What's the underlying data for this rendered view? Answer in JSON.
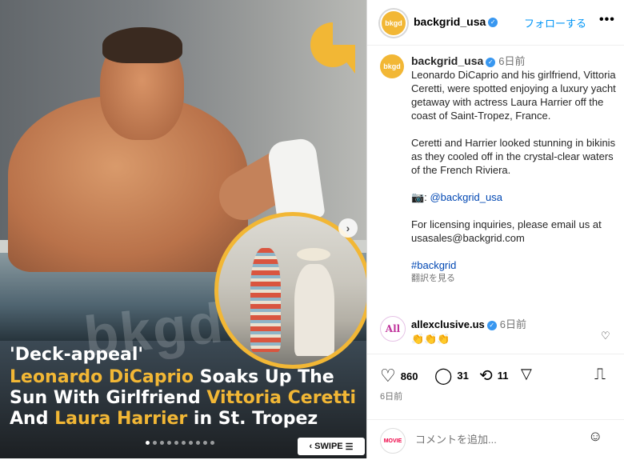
{
  "media": {
    "watermark": "bkgd",
    "caption_kicker": "'Deck-appeal'",
    "headline_parts": [
      {
        "text": "Leonardo DiCaprio",
        "highlight": true
      },
      {
        "text": " Soaks Up The Sun With Girlfriend ",
        "highlight": false
      },
      {
        "text": "Vittoria Ceretti",
        "highlight": true
      },
      {
        "text": " And ",
        "highlight": false
      },
      {
        "text": "Laura Harrier",
        "highlight": true
      },
      {
        "text": " in St. Tropez",
        "highlight": false
      }
    ],
    "swipe_label": "SWIPE",
    "slide_count": 10,
    "active_slide": 0,
    "next_icon": "chevron-right-icon",
    "accent_color": "#f2b735"
  },
  "header": {
    "avatar_text": "bkgd",
    "username": "backgrid_usa",
    "follow_label": "フォローする",
    "more_label": "•••"
  },
  "post": {
    "avatar_text": "bkgd",
    "username": "backgrid_usa",
    "time": "6日前",
    "paragraph1": "Leonardo DiCaprio and his girlfriend, Vittoria Ceretti, were spotted enjoying a luxury yacht getaway with actress Laura Harrier off the coast of Saint-Tropez, France.",
    "paragraph2": "Ceretti and Harrier looked stunning in bikinis as they cooled off in the crystal-clear waters of the French Riviera.",
    "camera_prefix": "📷:",
    "mention": "@backgrid_usa",
    "paragraph3": "For licensing inquiries, please email us at usasales@backgrid.com",
    "hashtag": "#backgrid",
    "translate_label": "翻訳を見る"
  },
  "comment": {
    "username": "allexclusive.us",
    "time": "6日前",
    "text": "👏👏👏",
    "avatar_text": "All"
  },
  "actions": {
    "likes": "860",
    "comments": "31",
    "reposts": "11",
    "date": "6日前"
  },
  "add_comment": {
    "placeholder": "コメントを追加...",
    "avatar_text": "MOVIE"
  }
}
